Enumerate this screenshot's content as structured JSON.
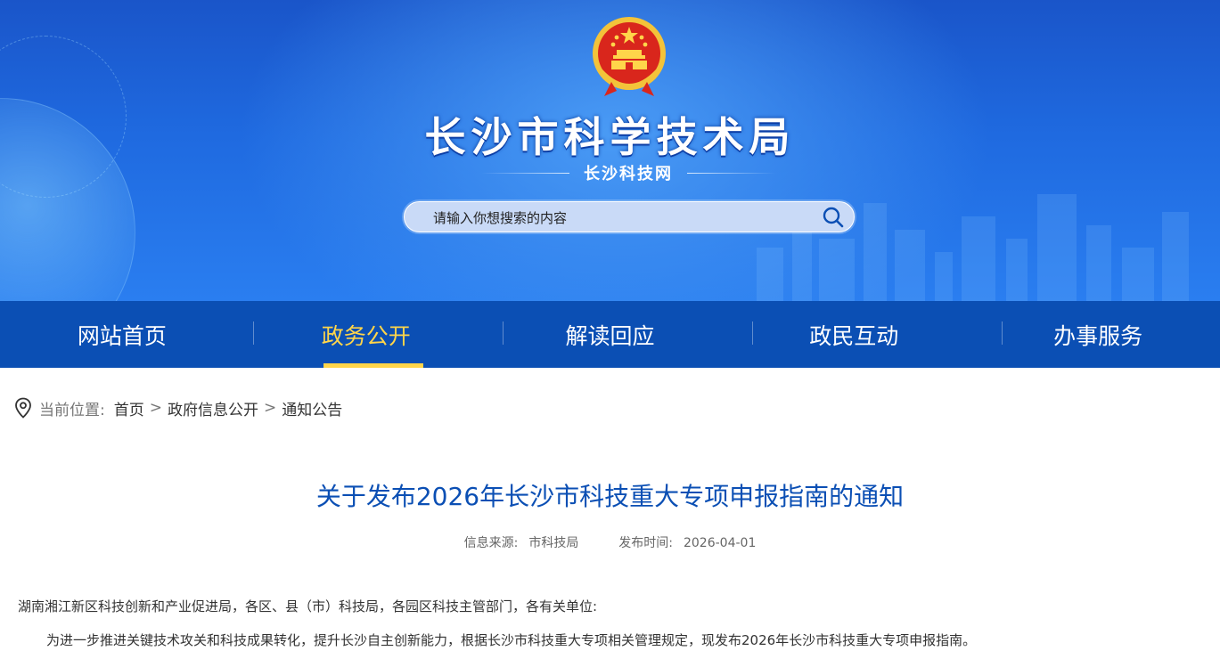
{
  "header": {
    "title": "长沙市科学技术局",
    "subtitle": "长沙科技网",
    "emblem_icon": "national-emblem-icon"
  },
  "search": {
    "placeholder": "请输入你想搜索的内容",
    "icon": "search-icon"
  },
  "nav": {
    "items": [
      {
        "label": "网站首页",
        "active": false
      },
      {
        "label": "政务公开",
        "active": true
      },
      {
        "label": "解读回应",
        "active": false
      },
      {
        "label": "政民互动",
        "active": false
      },
      {
        "label": "办事服务",
        "active": false
      }
    ]
  },
  "breadcrumb": {
    "icon": "location-pin-icon",
    "label": "当前位置:",
    "items": [
      "首页",
      "政府信息公开",
      "通知公告"
    ]
  },
  "article": {
    "title": "关于发布2026年长沙市科技重大专项申报指南的通知",
    "source_label": "信息来源:",
    "source_value": "市科技局",
    "date_label": "发布时间:",
    "date_value": "2026-04-01",
    "addressee": "湖南湘江新区科技创新和产业促进局，各区、县（市）科技局，各园区科技主管部门，各有关单位:",
    "body_first": "为进一步推进关键技术攻关和科技成果转化，提升长沙自主创新能力，根据长沙市科技重大专项相关管理规定，现发布2026年长沙市科技重大专项申报指南。"
  },
  "colors": {
    "nav_bg": "#0b4fb4",
    "nav_active": "#ffd54a",
    "title_color": "#0b4fb4"
  }
}
